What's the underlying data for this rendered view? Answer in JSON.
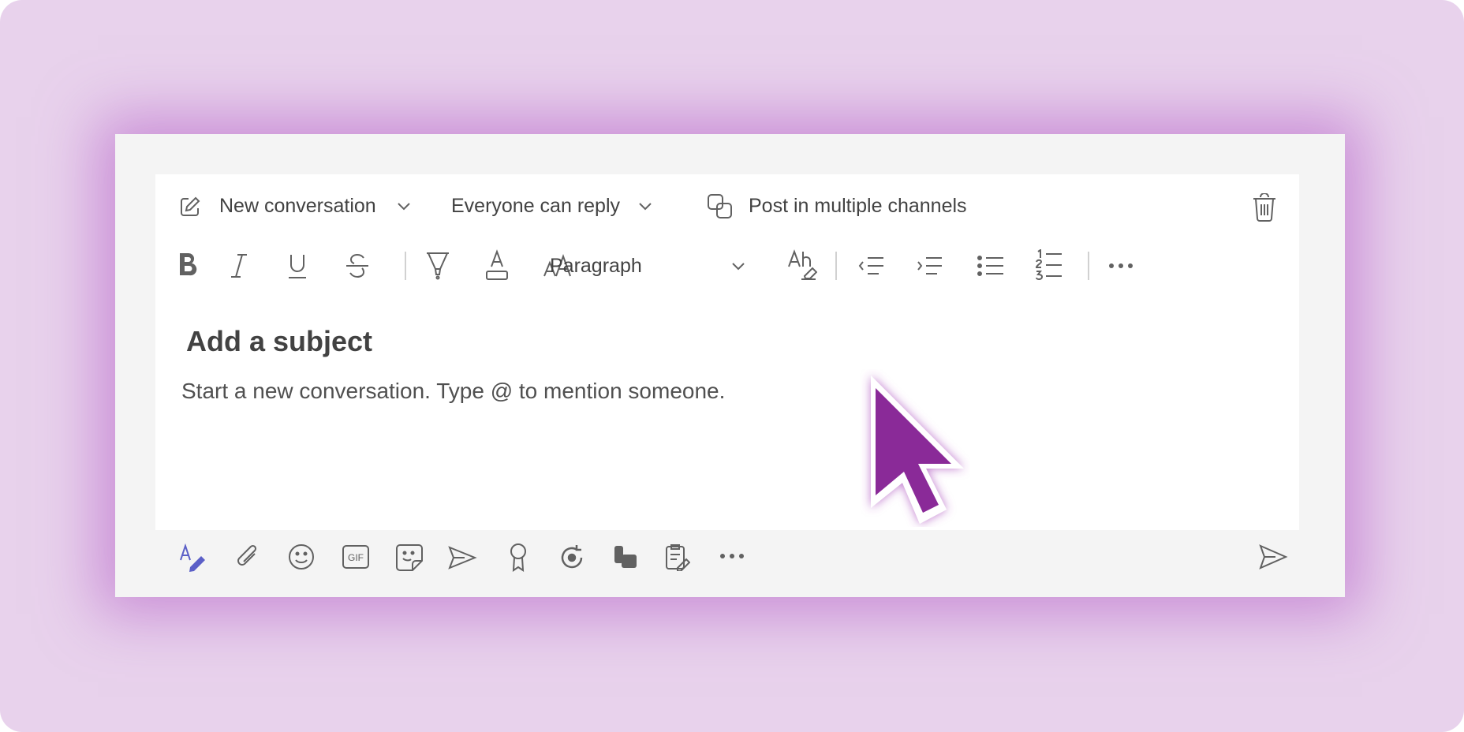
{
  "header": {
    "new_conversation": "New conversation",
    "reply_setting": "Everyone can reply",
    "post_multiple": "Post in multiple channels"
  },
  "format_toolbar": {
    "paragraph": "Paragraph"
  },
  "compose": {
    "subject_placeholder": "Add a subject",
    "body_placeholder": "Start a new conversation. Type @ to mention someone."
  },
  "icons": {
    "row1": [
      "compose-icon",
      "chevron-down-icon",
      "multiple-channels-icon",
      "trash-icon"
    ],
    "format": [
      "bold-icon",
      "italic-icon",
      "underline-icon",
      "strikethrough-icon",
      "highlight-icon",
      "font-color-icon",
      "font-size-icon",
      "clear-formatting-icon",
      "decrease-indent-icon",
      "increase-indent-icon",
      "bulleted-list-icon",
      "numbered-list-icon",
      "more-icon"
    ],
    "bottom": [
      "format-icon",
      "attach-icon",
      "emoji-icon",
      "gif-icon",
      "sticker-icon",
      "schedule-meeting-icon",
      "praise-icon",
      "loop-icon",
      "stream-icon",
      "approvals-icon",
      "more-icon",
      "send-icon"
    ]
  },
  "colors": {
    "backdrop": "#e8d2ec",
    "accent": "#5b5fc7",
    "cursor": "#8a2a98",
    "icon": "#616161"
  }
}
